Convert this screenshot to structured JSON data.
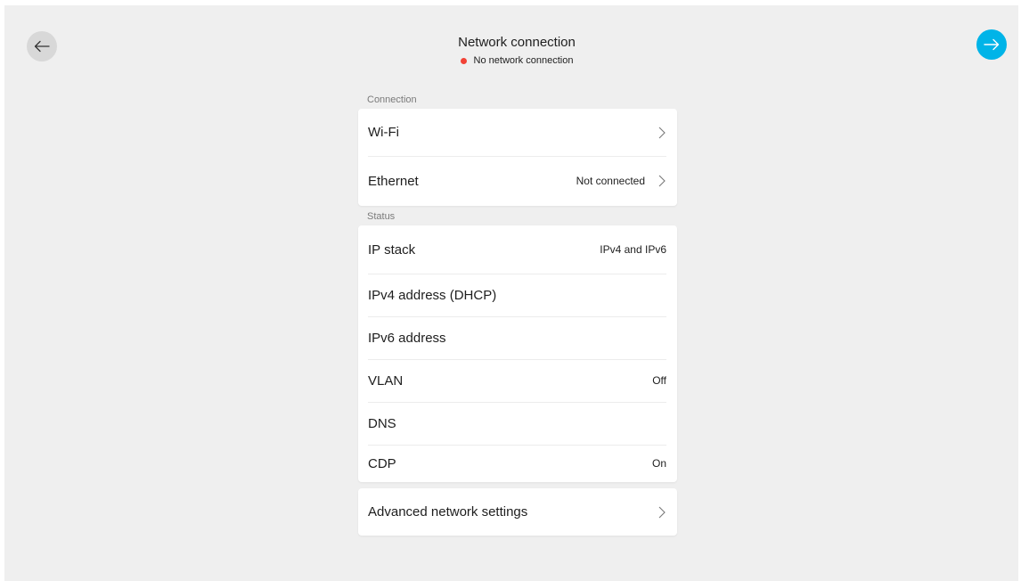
{
  "header": {
    "title": "Network connection",
    "status_text": "No network connection",
    "status_color": "#f24236"
  },
  "nav": {
    "back_icon": "arrow-left-icon",
    "next_icon": "arrow-right-icon",
    "next_color": "#00b4e8"
  },
  "connection": {
    "section_label": "Connection",
    "items": [
      {
        "label": "Wi-Fi",
        "value": ""
      },
      {
        "label": "Ethernet",
        "value": "Not connected"
      }
    ]
  },
  "status": {
    "section_label": "Status",
    "items": [
      {
        "label": "IP stack",
        "value": "IPv4 and IPv6"
      },
      {
        "label": "IPv4 address (DHCP)",
        "value": ""
      },
      {
        "label": "IPv6 address",
        "value": ""
      },
      {
        "label": "VLAN",
        "value": "Off"
      },
      {
        "label": "DNS",
        "value": ""
      },
      {
        "label": "CDP",
        "value": "On"
      }
    ]
  },
  "advanced": {
    "label": "Advanced network settings"
  }
}
